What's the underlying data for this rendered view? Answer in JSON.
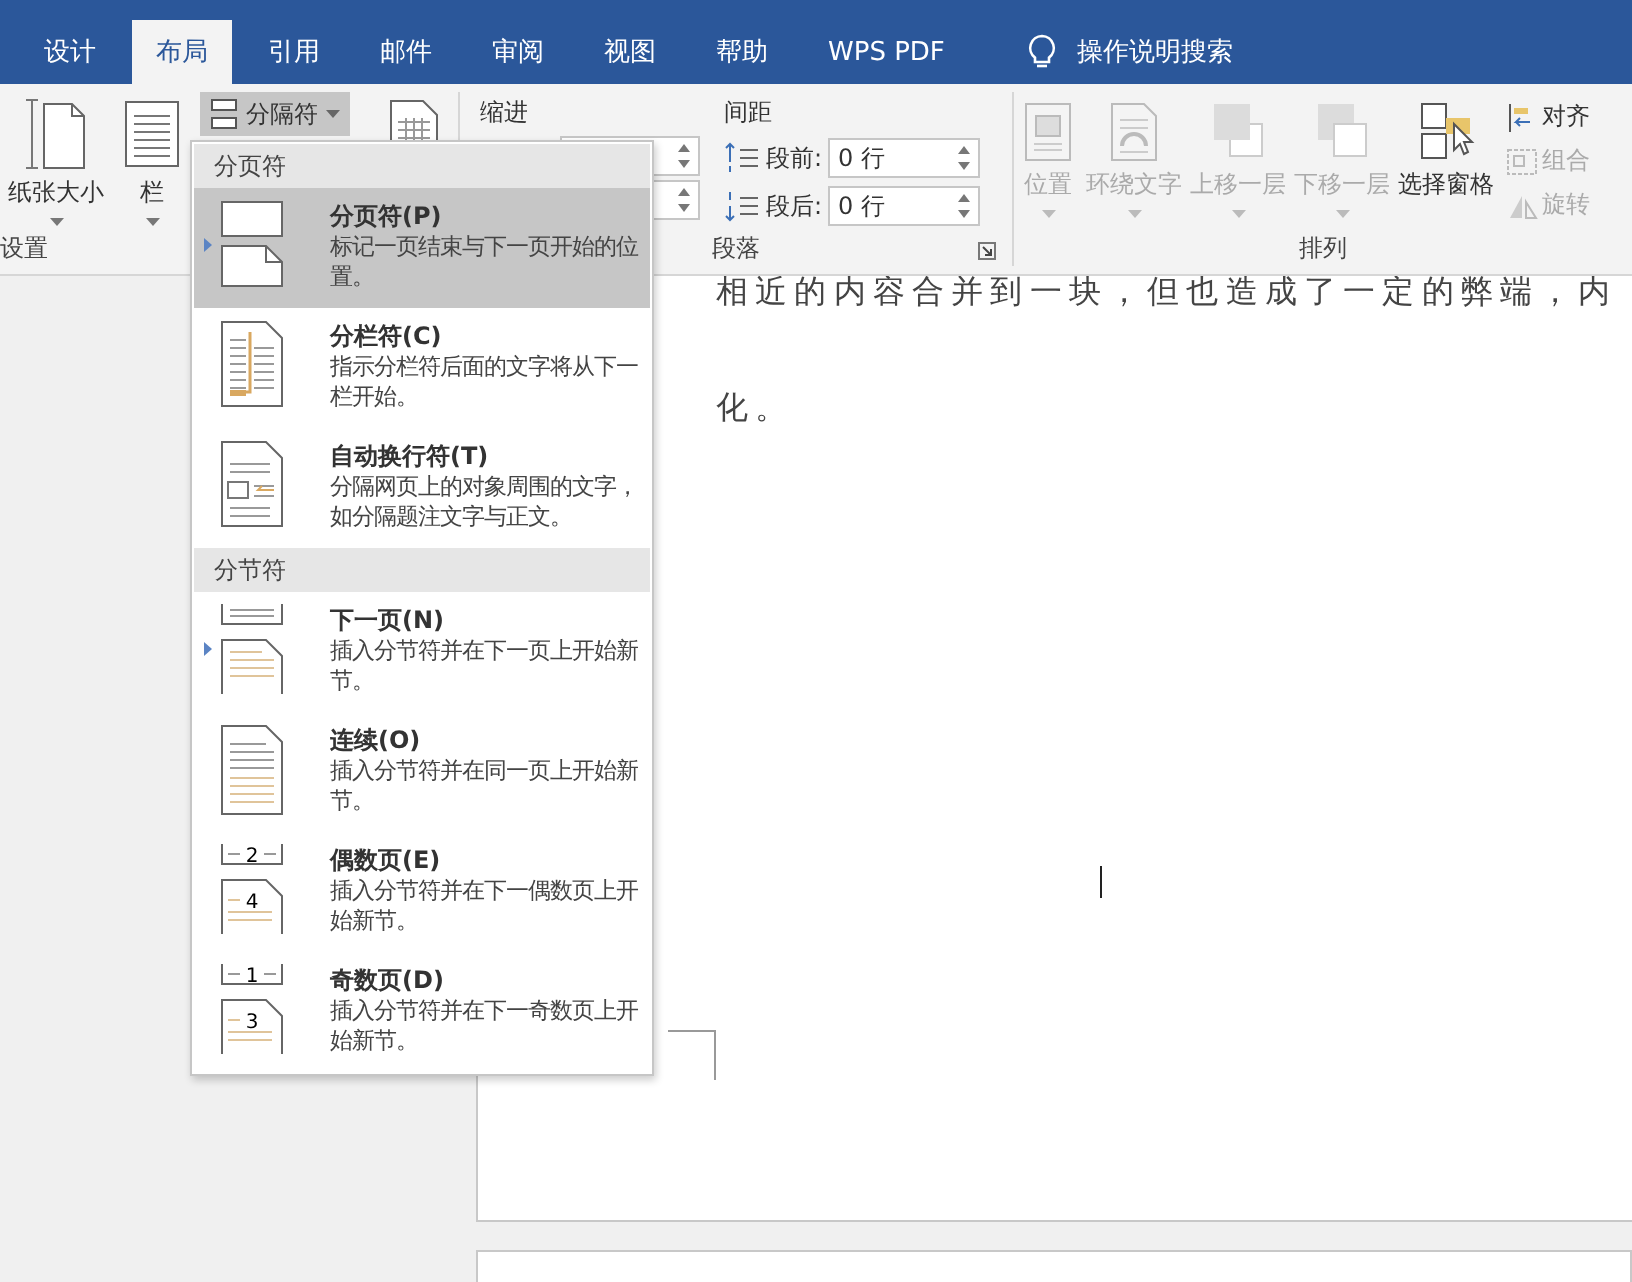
{
  "tabs": [
    {
      "label": "设计",
      "selected": false
    },
    {
      "label": "布局",
      "selected": true
    },
    {
      "label": "引用",
      "selected": false
    },
    {
      "label": "邮件",
      "selected": false
    },
    {
      "label": "审阅",
      "selected": false
    },
    {
      "label": "视图",
      "selected": false
    },
    {
      "label": "帮助",
      "selected": false
    },
    {
      "label": "WPS PDF",
      "selected": false
    }
  ],
  "tell_me": "操作说明搜索",
  "page_setup": {
    "label": "设置",
    "buttons": [
      {
        "label": "纸张大小"
      },
      {
        "label": "栏"
      }
    ],
    "breaks_button": {
      "label": "分隔符",
      "open": true
    }
  },
  "paragraph": {
    "label": "段落",
    "indent_label": "缩进",
    "spacing_label": "间距",
    "spacing": [
      {
        "label": "段前:",
        "value": "0 行"
      },
      {
        "label": "段后:",
        "value": "0 行"
      }
    ]
  },
  "arrange": {
    "label": "排列",
    "large": [
      {
        "label": "位置",
        "disabled": true,
        "dropdown": true
      },
      {
        "label": "环绕文字",
        "disabled": true,
        "dropdown": true
      },
      {
        "label": "上移一层",
        "disabled": true,
        "dropdown": true
      },
      {
        "label": "下移一层",
        "disabled": true,
        "dropdown": true
      },
      {
        "label": "选择窗格",
        "disabled": false,
        "dropdown": false
      }
    ],
    "small": [
      {
        "label": "对齐",
        "disabled": false
      },
      {
        "label": "组合",
        "disabled": true
      },
      {
        "label": "旋转",
        "disabled": true
      }
    ]
  },
  "document": {
    "lines": [
      "相近的内容合并到一块，但也造成了一定的弊端，内",
      "化。"
    ]
  },
  "breaks_menu": {
    "sections": [
      {
        "title": "分页符",
        "items": [
          {
            "title": "分页符(P)",
            "description": "标记一页结束与下一页开始的位置。",
            "kind": "page",
            "selected": true,
            "marked": true
          },
          {
            "title": "分栏符(C)",
            "description": "指示分栏符后面的文字将从下一栏开始。",
            "kind": "column",
            "selected": false,
            "marked": false
          },
          {
            "title": "自动换行符(T)",
            "description": "分隔网页上的对象周围的文字，如分隔题注文字与正文。",
            "kind": "textwrap",
            "selected": false,
            "marked": false
          }
        ]
      },
      {
        "title": "分节符",
        "items": [
          {
            "title": "下一页(N)",
            "description": "插入分节符并在下一页上开始新节。",
            "kind": "next",
            "selected": false,
            "marked": true
          },
          {
            "title": "连续(O)",
            "description": "插入分节符并在同一页上开始新节。",
            "kind": "continuous",
            "selected": false,
            "marked": false
          },
          {
            "title": "偶数页(E)",
            "description": "插入分节符并在下一偶数页上开始新节。",
            "kind": "numbered",
            "page_numbers": [
              "2",
              "4"
            ],
            "selected": false,
            "marked": false
          },
          {
            "title": "奇数页(D)",
            "description": "插入分节符并在下一奇数页上开始新节。",
            "kind": "numbered",
            "page_numbers": [
              "1",
              "3"
            ],
            "selected": false,
            "marked": false
          }
        ]
      }
    ]
  }
}
